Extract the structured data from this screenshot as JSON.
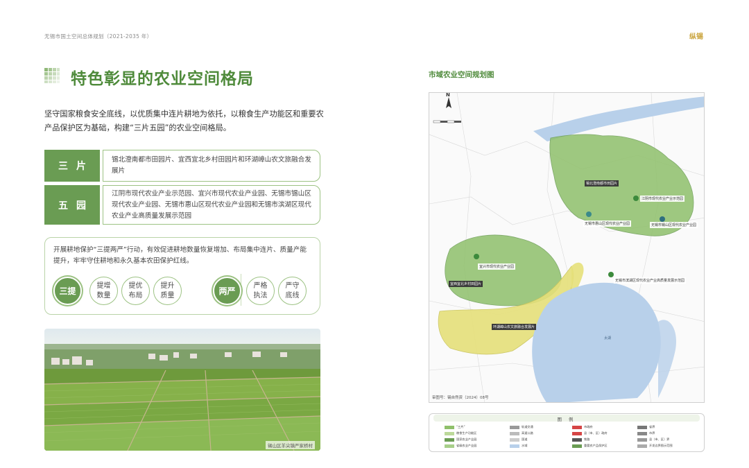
{
  "header": {
    "doc_title": "无锡市国土空间总体规划（2021-2035 年）",
    "logo_text": "纵锡"
  },
  "section": {
    "title": "特色彰显的农业空间格局",
    "intro": "坚守国家粮食安全底线，以优质集中连片耕地为依托，以粮食生产功能区和重要农产品保护区为基础，构建“三片五园”的农业空间格局。"
  },
  "categories": [
    {
      "label": "三片",
      "text": "锡北澄南都市田园片、宜西宜北乡村田园片和环湖嶂山农文旅融合发展片"
    },
    {
      "label": "五园",
      "text": "江阴市现代农业产业示范园、宜兴市现代农业产业园、无锡市锡山区现代农业产业园、无锡市惠山区现代农业产业园和无锡市滨湖区现代农业产业高质量发展示范园"
    }
  ],
  "protection": {
    "text": "开展耕地保护“三提两严”行动，有效促进耕地数量恢复增加、布局集中连片、质量产能提升，牢牢守住耕地和永久基本农田保护红线。",
    "group1": {
      "main": "三提",
      "items": [
        "提增数量",
        "提优布局",
        "提升质量"
      ]
    },
    "group2": {
      "main": "两严",
      "items": [
        "严格执法",
        "严守底线"
      ]
    }
  },
  "photo": {
    "caption": "锡山区羊尖镇严家桥村"
  },
  "map": {
    "title": "市域农业空间规划图",
    "north": "N",
    "note": "审图号：锡自然资（2024）08号",
    "areas": [
      {
        "label": "锡北澄南都市田园片",
        "color": "#8fc06b"
      },
      {
        "label": "宜西宜北乡村田园片",
        "color": "#8fc06b"
      },
      {
        "label": "环湖嶂山农文旅融合发展片",
        "color": "#e6e07a"
      }
    ],
    "parks": [
      "江阴市现代农业产业示范园",
      "无锡市锡山区现代农业产业园",
      "无锡市惠山区现代农业产业园",
      "宜兴市现代农业产业园",
      "无锡市滨湖区现代农业产业高质量发展示范园"
    ],
    "lake_color": "#b8d0ea",
    "place_labels": [
      "太湖"
    ]
  },
  "legend": {
    "title": "图 例",
    "items": [
      {
        "label": "“三片”",
        "color": "#8fc06b"
      },
      {
        "label": "粮食生产功能区",
        "color": "#bcd99a"
      },
      {
        "label": "国家农业产业园",
        "color": "#6a9c53"
      },
      {
        "label": "省级农业产业园",
        "color": "#a8cf8a"
      },
      {
        "label": "轨道交通",
        "color": "#999999"
      },
      {
        "label": "高速公路",
        "color": "#bbbbbb"
      },
      {
        "label": "国道",
        "color": "#cccccc"
      },
      {
        "label": "水域",
        "color": "#b8d0ea"
      },
      {
        "label": "市政府",
        "color": "#d64545"
      },
      {
        "label": "县（市、区）政府",
        "color": "#d64545"
      },
      {
        "label": "铁路",
        "color": "#555555"
      },
      {
        "label": "重要农产品保护区",
        "color": "#6a9c53"
      },
      {
        "label": "省界",
        "color": "#777777"
      },
      {
        "label": "市界",
        "color": "#888888"
      },
      {
        "label": "县（市、区）界",
        "color": "#999999"
      },
      {
        "label": "开发边界图示范围",
        "color": "#aaaaaa"
      }
    ]
  }
}
